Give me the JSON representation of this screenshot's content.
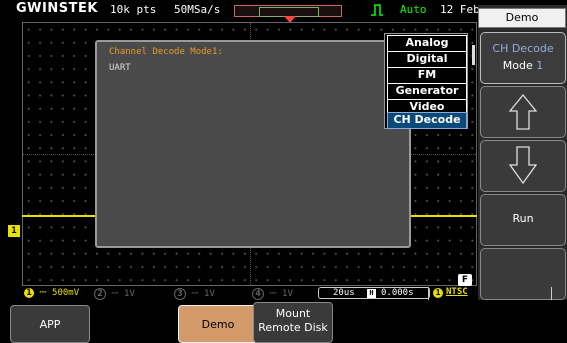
{
  "topbar": {
    "brand": "GWINSTEK",
    "memory": "10k pts",
    "sample_rate": "50MSa/s",
    "trigger_mode": "Auto",
    "date": "12 Feb"
  },
  "dialog": {
    "title": "Channel Decode Mode1:",
    "value": "UART"
  },
  "popup": {
    "items": [
      "Analog",
      "Digital",
      "FM",
      "Generator",
      "Video",
      "CH Decode"
    ],
    "selected": "CH Decode"
  },
  "right_panel": {
    "title": "Demo",
    "softkey1_line1": "CH Decode",
    "softkey1_line2": "Mode",
    "softkey1_value": "1",
    "up_icon": "arrow-up-icon",
    "down_icon": "arrow-down-icon",
    "run_label": "Run"
  },
  "status": {
    "ch1_num": "1",
    "ch1_scale": "500mV",
    "ch2_num": "2",
    "ch2_scale": "1V",
    "ch3_num": "3",
    "ch3_scale": "1V",
    "ch4_num": "4",
    "ch4_scale": "1V",
    "timebase": "20us",
    "h_label": "H",
    "h_offset": "0.000s",
    "trig_source": "1",
    "video_std": "NTSC",
    "f_badge": "F"
  },
  "channel_marker": "1",
  "bottom_softkeys": {
    "app": "APP",
    "demo": "Demo",
    "mount_line1": "Mount",
    "mount_line2": "Remote Disk"
  },
  "colors": {
    "ch1": "#e8e000",
    "dialog_title": "#e89a2a",
    "selected_item": "#0a4a7a"
  }
}
